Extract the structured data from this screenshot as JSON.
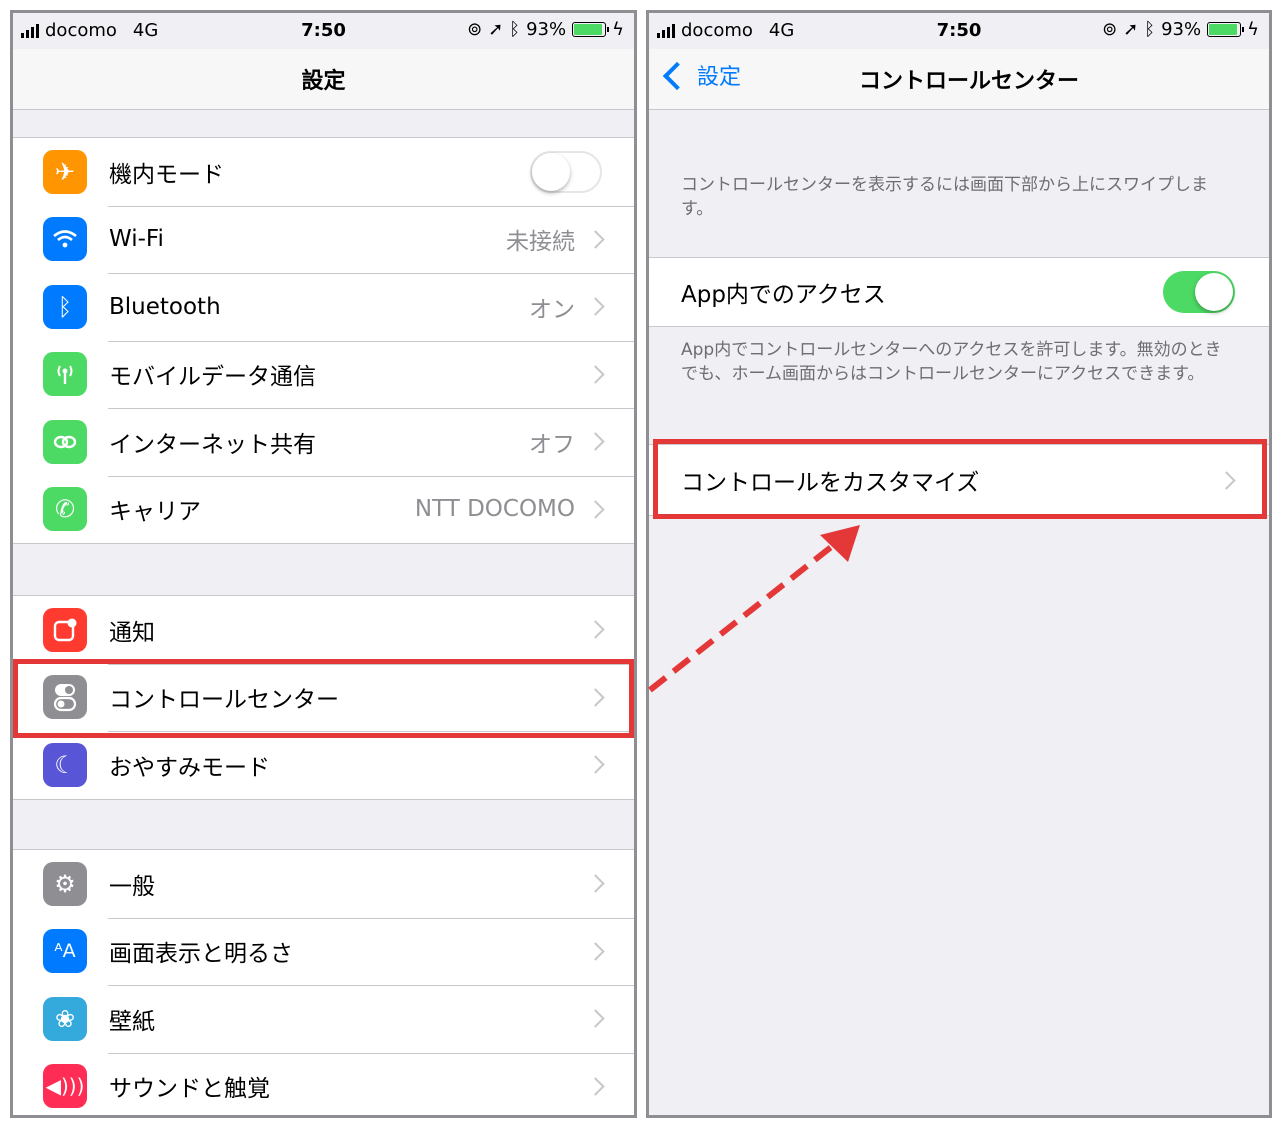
{
  "status_bar": {
    "carrier": "docomo",
    "network": "4G",
    "time": "7:50",
    "battery": "93%",
    "battery_fraction": 0.93
  },
  "left_screen": {
    "title": "設定",
    "groups": [
      {
        "rows": [
          {
            "icon": "airplane-icon",
            "icon_color": "#ff9500",
            "label": "機内モード",
            "toggle": "off"
          },
          {
            "icon": "wifi-icon",
            "icon_color": "#007aff",
            "label": "Wi-Fi",
            "value": "未接続"
          },
          {
            "icon": "bluetooth-icon",
            "icon_color": "#007aff",
            "label": "Bluetooth",
            "value": "オン"
          },
          {
            "icon": "cellular-icon",
            "icon_color": "#4cd964",
            "label": "モバイルデータ通信"
          },
          {
            "icon": "hotspot-icon",
            "icon_color": "#4cd964",
            "label": "インターネット共有",
            "value": "オフ"
          },
          {
            "icon": "phone-icon",
            "icon_color": "#4cd964",
            "label": "キャリア",
            "value": "NTT DOCOMO"
          }
        ]
      },
      {
        "rows": [
          {
            "icon": "notifications-icon",
            "icon_color": "#ff3b30",
            "label": "通知"
          },
          {
            "icon": "control-center-icon",
            "icon_color": "#8e8e93",
            "label": "コントロールセンター"
          },
          {
            "icon": "moon-icon",
            "icon_color": "#5856d6",
            "label": "おやすみモード"
          }
        ]
      },
      {
        "rows": [
          {
            "icon": "gear-icon",
            "icon_color": "#8e8e93",
            "label": "一般"
          },
          {
            "icon": "display-icon",
            "icon_color": "#007aff",
            "label": "画面表示と明るさ"
          },
          {
            "icon": "wallpaper-icon",
            "icon_color": "#34aadc",
            "label": "壁紙"
          },
          {
            "icon": "sound-icon",
            "icon_color": "#ff2d55",
            "label": "サウンドと触覚"
          }
        ]
      }
    ]
  },
  "right_screen": {
    "back_label": "設定",
    "title": "コントロールセンター",
    "intro_note": "コントロールセンターを表示するには画面下部から上にスワイプします。",
    "access_label": "App内でのアクセス",
    "access_toggle": "on",
    "access_note": "App内でコントロールセンターへのアクセスを許可します。無効のときでも、ホーム画面からはコントロールセンターにアクセスできます。",
    "customize_label": "コントロールをカスタマイズ"
  },
  "colors": {
    "highlight": "#e43838",
    "toggle_on": "#4cd964",
    "link": "#007aff"
  }
}
